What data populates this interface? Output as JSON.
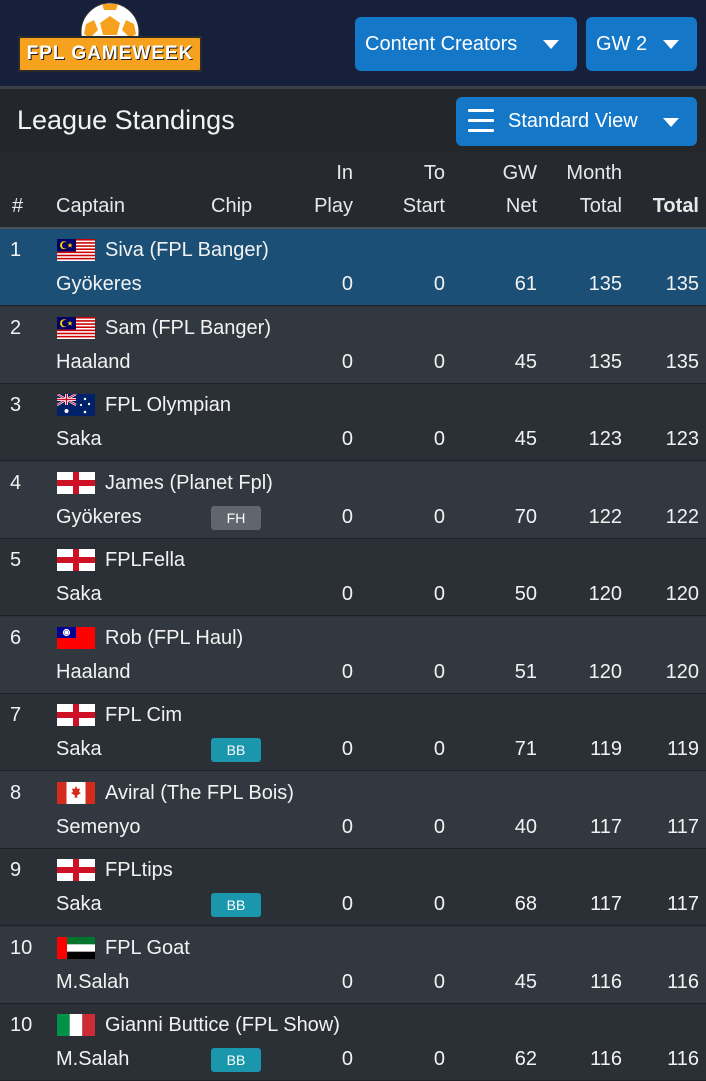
{
  "header": {
    "logo_text": "FPL GAMEWEEK",
    "league_dropdown": "Content Creators",
    "gameweek_dropdown": "GW 2"
  },
  "section": {
    "title": "League Standings",
    "view_button": "Standard View"
  },
  "table": {
    "columns": {
      "rank": "#",
      "captain": "Captain",
      "chip": "Chip",
      "in_play_1": "In",
      "in_play_2": "Play",
      "to_start_1": "To",
      "to_start_2": "Start",
      "gw_net_1": "GW",
      "gw_net_2": "Net",
      "month_total_1": "Month",
      "month_total_2": "Total",
      "total": "Total"
    },
    "rows": [
      {
        "rank": "1",
        "name": "Siva (FPL Banger)",
        "flag": "malaysia",
        "captain": "Gyökeres",
        "chip": "",
        "in_play": "0",
        "to_start": "0",
        "gw_net": "61",
        "month_total": "135",
        "total": "135"
      },
      {
        "rank": "2",
        "name": "Sam (FPL Banger)",
        "flag": "malaysia",
        "captain": "Haaland",
        "chip": "",
        "in_play": "0",
        "to_start": "0",
        "gw_net": "45",
        "month_total": "135",
        "total": "135"
      },
      {
        "rank": "3",
        "name": "FPL Olympian",
        "flag": "australia",
        "captain": "Saka",
        "chip": "",
        "in_play": "0",
        "to_start": "0",
        "gw_net": "45",
        "month_total": "123",
        "total": "123"
      },
      {
        "rank": "4",
        "name": "James (Planet Fpl)",
        "flag": "england",
        "captain": "Gyökeres",
        "chip": "FH",
        "in_play": "0",
        "to_start": "0",
        "gw_net": "70",
        "month_total": "122",
        "total": "122"
      },
      {
        "rank": "5",
        "name": "FPLFella",
        "flag": "england",
        "captain": "Saka",
        "chip": "",
        "in_play": "0",
        "to_start": "0",
        "gw_net": "50",
        "month_total": "120",
        "total": "120"
      },
      {
        "rank": "6",
        "name": "Rob (FPL Haul)",
        "flag": "taiwan",
        "captain": "Haaland",
        "chip": "",
        "in_play": "0",
        "to_start": "0",
        "gw_net": "51",
        "month_total": "120",
        "total": "120"
      },
      {
        "rank": "7",
        "name": "FPL Cim",
        "flag": "england",
        "captain": "Saka",
        "chip": "BB",
        "in_play": "0",
        "to_start": "0",
        "gw_net": "71",
        "month_total": "119",
        "total": "119"
      },
      {
        "rank": "8",
        "name": "Aviral (The FPL Bois)",
        "flag": "canada",
        "captain": "Semenyo",
        "chip": "",
        "in_play": "0",
        "to_start": "0",
        "gw_net": "40",
        "month_total": "117",
        "total": "117"
      },
      {
        "rank": "9",
        "name": "FPLtips",
        "flag": "england",
        "captain": "Saka",
        "chip": "BB",
        "in_play": "0",
        "to_start": "0",
        "gw_net": "68",
        "month_total": "117",
        "total": "117"
      },
      {
        "rank": "10",
        "name": "FPL Goat",
        "flag": "uae",
        "captain": "M.Salah",
        "chip": "",
        "in_play": "0",
        "to_start": "0",
        "gw_net": "45",
        "month_total": "116",
        "total": "116"
      },
      {
        "rank": "10",
        "name": "Gianni Buttice (FPL Show)",
        "flag": "italy",
        "captain": "M.Salah",
        "chip": "BB",
        "in_play": "0",
        "to_start": "0",
        "gw_net": "62",
        "month_total": "116",
        "total": "116"
      }
    ]
  },
  "colors": {
    "header_bg": "#17203a",
    "accent_blue": "#1577c8",
    "highlight_row": "#1c4f76",
    "chip_bb": "#1b97ad",
    "chip_fh": "#60666e",
    "logo_orange": "#f6a21e"
  }
}
